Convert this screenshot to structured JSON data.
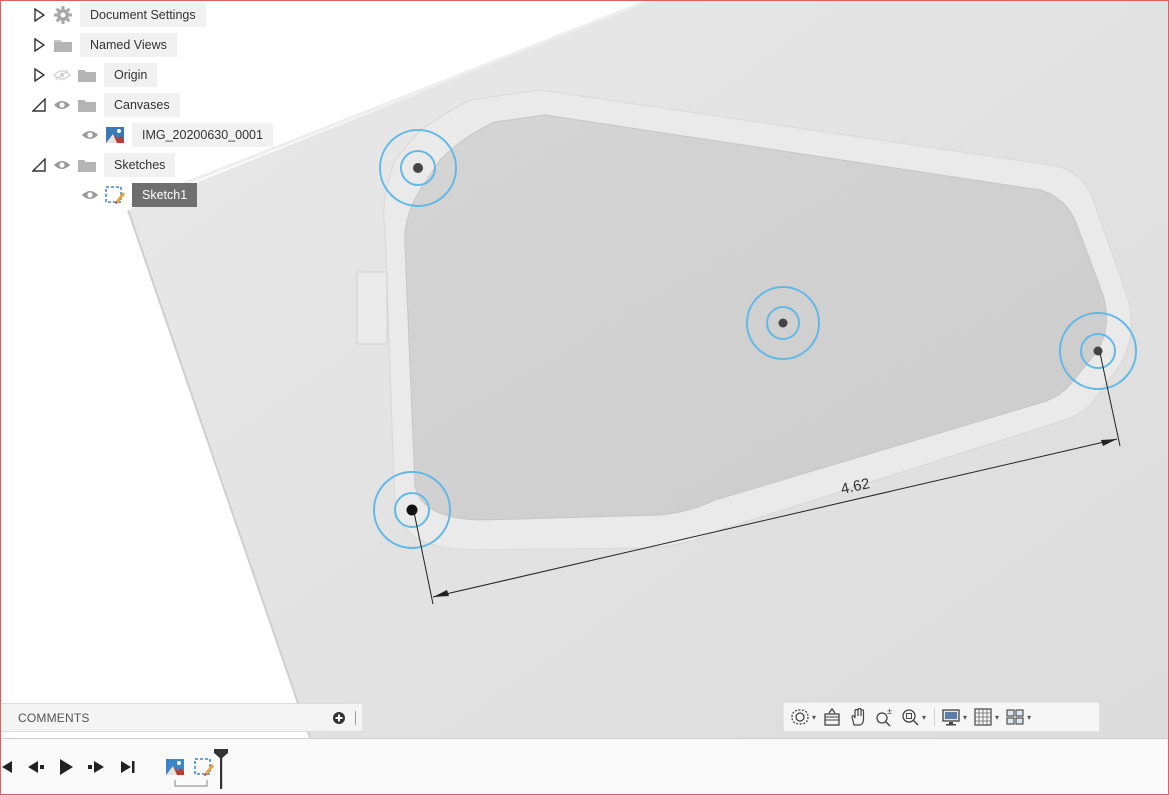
{
  "browser": {
    "items": [
      {
        "label": "Document Settings",
        "icon": "gear-icon",
        "expanded": false,
        "visibility": "none"
      },
      {
        "label": "Named Views",
        "icon": "folder-icon",
        "expanded": false,
        "visibility": "none"
      },
      {
        "label": "Origin",
        "icon": "folder-icon",
        "expanded": false,
        "visibility": "hidden"
      },
      {
        "label": "Canvases",
        "icon": "folder-icon",
        "expanded": true,
        "visibility": "visible"
      },
      {
        "label": "IMG_20200630_0001",
        "icon": "canvas-image-icon",
        "child": true,
        "visibility": "visible"
      },
      {
        "label": "Sketches",
        "icon": "folder-icon",
        "expanded": true,
        "visibility": "visible"
      },
      {
        "label": "Sketch1",
        "icon": "sketch-icon",
        "child": true,
        "visibility": "visible",
        "selected": true
      }
    ]
  },
  "canvas": {
    "dimension_value": "4.62"
  },
  "comments": {
    "title": "COMMENTS"
  },
  "navbar": {
    "icons": [
      "orbit-icon",
      "look-at-icon",
      "pan-icon",
      "zoom-icon",
      "fit-icon",
      "display-settings-icon",
      "grid-settings-icon",
      "viewports-icon"
    ]
  },
  "timeline": {
    "controls": [
      "first-icon",
      "previous-icon",
      "play-icon",
      "next-icon",
      "last-icon"
    ],
    "features": [
      "canvas-feature-icon",
      "sketch-feature-icon"
    ]
  },
  "colors": {
    "accent_blue": "#63b9e6",
    "selected_bg": "#6f6f6f",
    "frame_red": "#e06060"
  }
}
